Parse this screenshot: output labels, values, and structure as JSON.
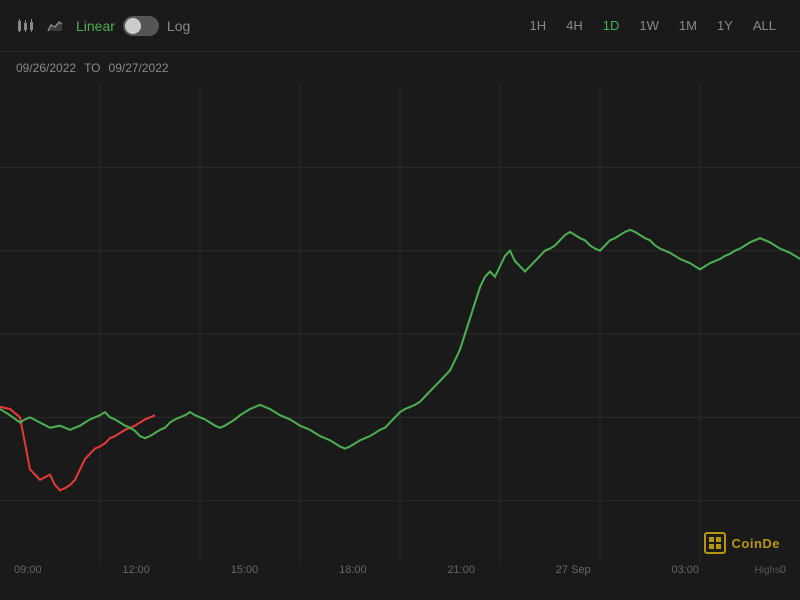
{
  "toolbar": {
    "linear_label": "Linear",
    "log_label": "Log",
    "time_buttons": [
      "1H",
      "4H",
      "1D",
      "1W",
      "1M",
      "1Y",
      "ALL"
    ],
    "active_time": "1D"
  },
  "date_range": {
    "from": "09/26/2022",
    "to_label": "TO",
    "to": "09/27/2022"
  },
  "x_axis_labels": [
    "09:00",
    "12:00",
    "15:00",
    "18:00",
    "21:00",
    "27 Sep",
    "03:00",
    "0"
  ],
  "watermark": {
    "icon": "₿",
    "text": "CoinDe"
  },
  "bottom_label": "Highs",
  "colors": {
    "green": "#4caf50",
    "red": "#e53935",
    "background": "#1a1a1a",
    "grid": "#2a2a2a",
    "accent_gold": "#b8960c"
  }
}
